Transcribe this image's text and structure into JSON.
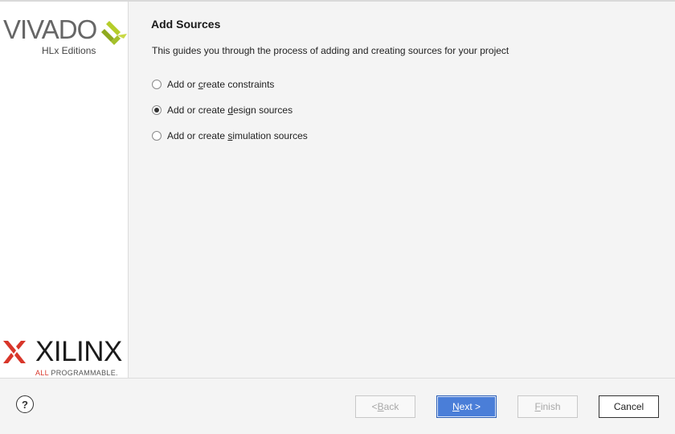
{
  "branding": {
    "vivado": "VIVADO",
    "vivado_sub": "HLx Editions",
    "xilinx": "XILINX",
    "xilinx_tag_all": "ALL",
    "xilinx_tag_rest": " PROGRAMMABLE."
  },
  "page": {
    "title": "Add Sources",
    "description": "This guides you through the process of adding and creating sources for your project"
  },
  "options": [
    {
      "pre": "Add or ",
      "underlined": "c",
      "post": "reate constraints",
      "checked": false
    },
    {
      "pre": "Add or create ",
      "underlined": "d",
      "post": "esign sources",
      "checked": true
    },
    {
      "pre": "Add or create ",
      "underlined": "s",
      "post": "imulation sources",
      "checked": false
    }
  ],
  "footer": {
    "help_symbol": "?",
    "back_pre": "< ",
    "back_u": "B",
    "back_post": "ack",
    "next_u": "N",
    "next_post": "ext >",
    "finish_u": "F",
    "finish_post": "inish",
    "cancel": "Cancel"
  },
  "colors": {
    "primary_button": "#4a7ed8",
    "xilinx_red": "#d8362a",
    "vivado_green": "#b5cd2a"
  }
}
